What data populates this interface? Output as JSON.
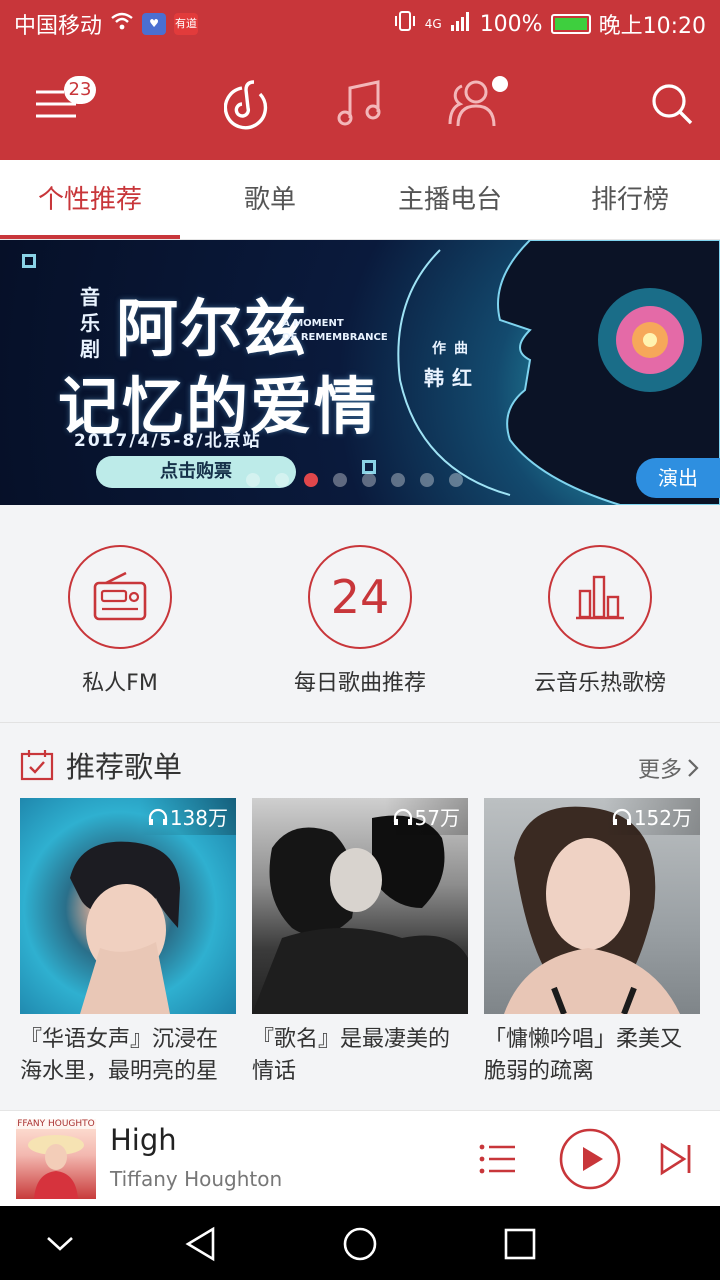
{
  "status_bar": {
    "carrier": "中国移动",
    "network": "4G",
    "battery": "100%",
    "time": "晚上10:20",
    "app_badge_text": "有道"
  },
  "app_bar": {
    "menu_badge": "23",
    "icons": [
      "menu-icon",
      "netease-music-logo-icon",
      "music-note-icon",
      "friends-icon",
      "search-icon"
    ],
    "accent_color": "#c8363a"
  },
  "tabs": [
    {
      "label": "个性推荐",
      "active": true
    },
    {
      "label": "歌单",
      "active": false
    },
    {
      "label": "主播电台",
      "active": false
    },
    {
      "label": "排行榜",
      "active": false
    }
  ],
  "banner": {
    "category": "音乐剧",
    "title_line1": "阿尔兹",
    "title_line2": "记忆的爱情",
    "subtitle_en_1": "A MOMENT",
    "subtitle_en_2": "OF REMEMBRANCE",
    "composer_label": "作曲",
    "composer": "韩红",
    "date": "2017/4/5-8/北京站",
    "cta": "点击购票",
    "tag": "演出",
    "page_count": 8,
    "active_page": 3
  },
  "quick_actions": [
    {
      "label": "私人FM",
      "icon": "radio-icon",
      "value": ""
    },
    {
      "label": "每日歌曲推荐",
      "icon": "calendar-day-icon",
      "value": "24"
    },
    {
      "label": "云音乐热歌榜",
      "icon": "bar-chart-icon",
      "value": ""
    }
  ],
  "recommended": {
    "title": "推荐歌单",
    "more": "更多",
    "playlists": [
      {
        "count": "138万",
        "title": "『华语女声』沉浸在海水里，最明亮的星"
      },
      {
        "count": "57万",
        "title": "『歌名』是最凄美的情话"
      },
      {
        "count": "152万",
        "title": "「慵懒吟唱」柔美又脆弱的疏离"
      }
    ]
  },
  "player": {
    "art_text": "FFANY HOUGHTO",
    "title": "High",
    "artist": "Tiffany Houghton"
  },
  "nav": [
    "back-down-icon",
    "back-icon",
    "home-icon",
    "recents-icon"
  ]
}
